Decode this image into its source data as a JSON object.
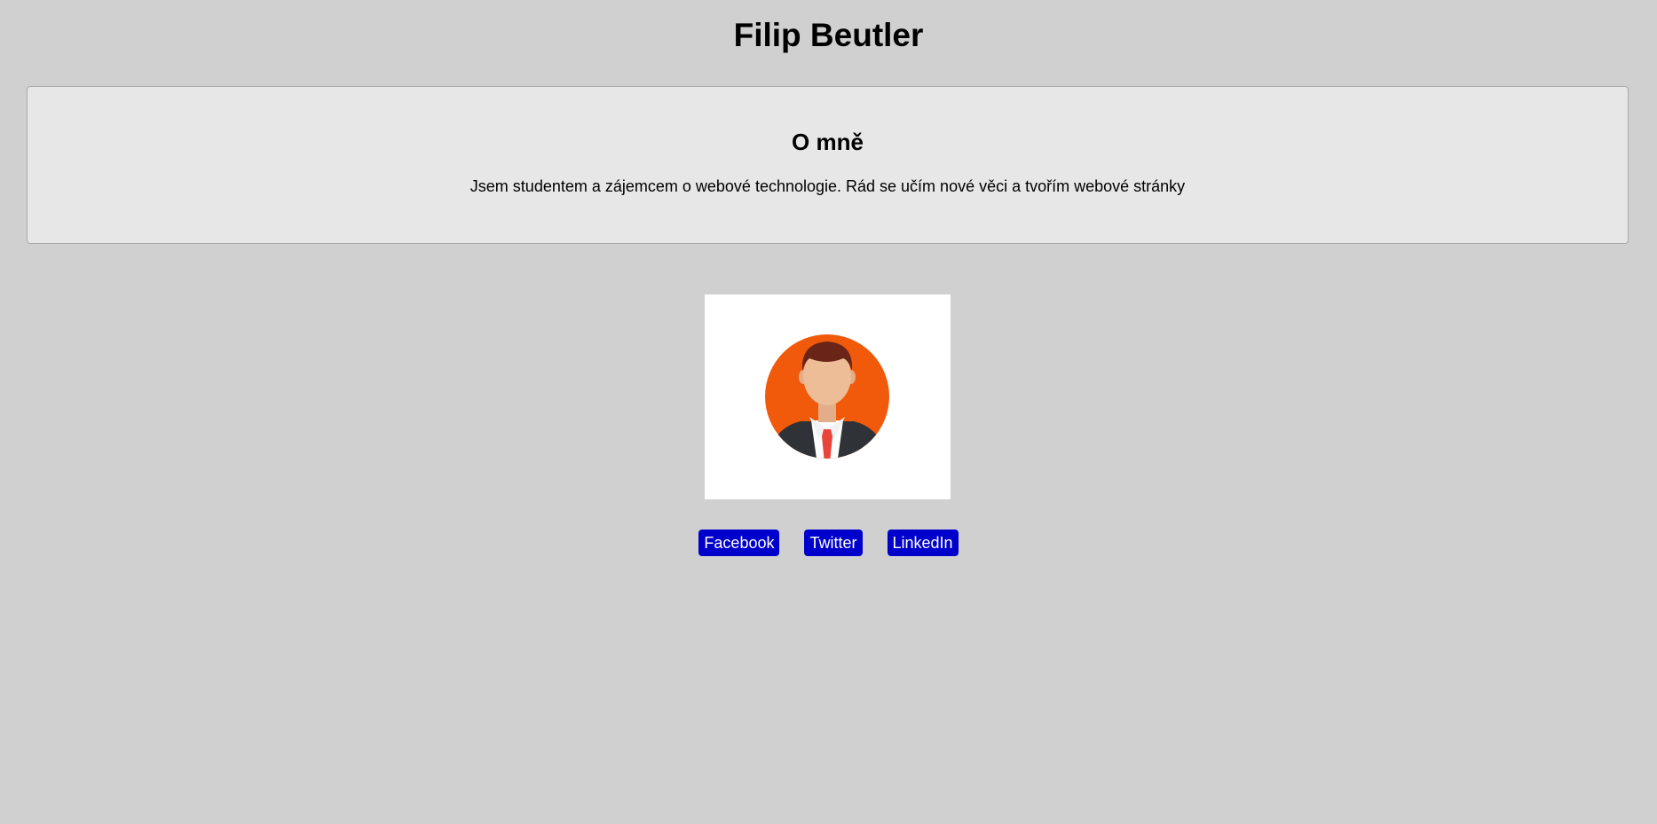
{
  "header": {
    "name": "Filip Beutler"
  },
  "about": {
    "heading": "O mně",
    "text": "Jsem studentem a zájemcem o webové technologie. Rád se učím nové věci a tvořím webové stránky"
  },
  "profile_image": {
    "icon": "user-avatar-icon",
    "background_color": "#f05a0a"
  },
  "social": {
    "links": [
      {
        "label": "Facebook"
      },
      {
        "label": "Twitter"
      },
      {
        "label": "LinkedIn"
      }
    ],
    "button_color": "#0000cc"
  },
  "colors": {
    "page_background": "#d0d0d0",
    "box_background": "#e7e7e7"
  }
}
